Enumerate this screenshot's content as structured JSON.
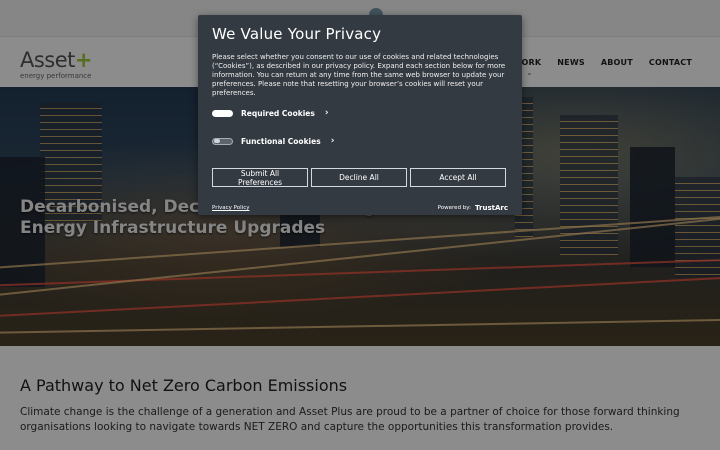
{
  "header": {
    "logo_main": "Asset",
    "logo_plus": "+",
    "logo_sub": "energy performance",
    "nav": [
      "OUR WORK",
      "NEWS",
      "ABOUT",
      "CONTACT"
    ]
  },
  "hero": {
    "title_line1": "Decarbonised, Decentralised and Digitalised",
    "title_line2": "Energy Infrastructure Upgrades"
  },
  "content": {
    "heading": "A Pathway to Net Zero Carbon Emissions",
    "body": "Climate change is the challenge of a generation and Asset Plus are proud to be a partner of choice for those forward thinking organisations looking to navigate towards NET ZERO and capture the opportunities this transformation provides."
  },
  "privacy": {
    "title": "We Value Your Privacy",
    "description": "Please select whether you consent to our use of cookies and related technologies (“Cookies”), as described in our privacy policy. Expand each section below for more information. You can return at any time from the same web browser to update your preferences. Please note that resetting your browser’s cookies will reset your preferences.",
    "required_label": "Required Cookies",
    "functional_label": "Functional Cookies",
    "buttons": {
      "submit": "Submit All Preferences",
      "decline": "Decline All",
      "accept": "Accept All"
    },
    "policy_link": "Privacy Policy",
    "powered_by": "Powered by:",
    "brand": "TrustArc"
  }
}
